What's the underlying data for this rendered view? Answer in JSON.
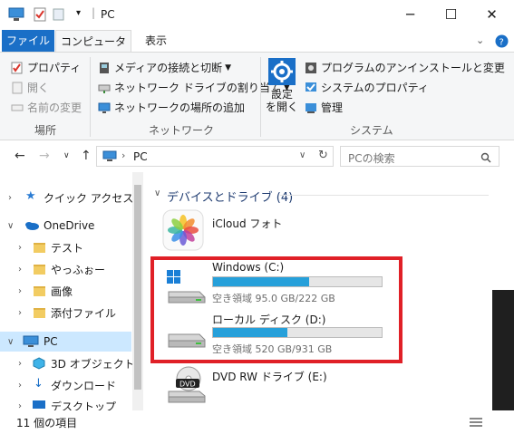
{
  "window": {
    "title": "PC",
    "buttons": {
      "minimize": "─",
      "maximize": "☐",
      "close": "✕"
    }
  },
  "ribbon": {
    "tabs": [
      "ファイル",
      "コンピューター",
      "表示"
    ],
    "location_group": {
      "label": "場所",
      "items": [
        "プロパティ",
        "開く",
        "名前の変更"
      ]
    },
    "network_group": {
      "label": "ネットワーク",
      "items": [
        "メディアの接続と切断",
        "ネットワーク ドライブの割り当て",
        "ネットワークの場所の追加"
      ]
    },
    "system_group": {
      "label": "システム",
      "settings_line1": "設定",
      "settings_line2": "を開く",
      "items": [
        "プログラムのアンインストールと変更",
        "システムのプロパティ",
        "管理"
      ]
    }
  },
  "address": {
    "path": "PC",
    "search_placeholder": "PCの検索"
  },
  "nav": {
    "items": [
      {
        "label": "クイック アクセス"
      },
      {
        "label": "OneDrive"
      },
      {
        "label": "テスト"
      },
      {
        "label": "やっふぉー"
      },
      {
        "label": "画像"
      },
      {
        "label": "添付ファイル"
      },
      {
        "label": "PC"
      },
      {
        "label": "3D オブジェクト"
      },
      {
        "label": "ダウンロード"
      },
      {
        "label": "デスクトップ"
      }
    ]
  },
  "content": {
    "section_title": "デバイスとドライブ (4)",
    "icloud": "iCloud フォト",
    "drives": [
      {
        "name": "Windows (C:)",
        "free": "空き領域 95.0 GB/222 GB",
        "used_fraction": 0.57
      },
      {
        "name": "ローカル ディスク (D:)",
        "free": "空き領域 520 GB/931 GB",
        "used_fraction": 0.44
      }
    ],
    "dvd": {
      "name": "DVD RW ドライブ (E:)",
      "badge": "DVD"
    }
  },
  "status": {
    "items": "11 個の項目"
  },
  "colors": {
    "accent": "#1a6fc7",
    "selected": "#cce8ff",
    "bar": "#26a0da",
    "highlight": "#e02027"
  }
}
